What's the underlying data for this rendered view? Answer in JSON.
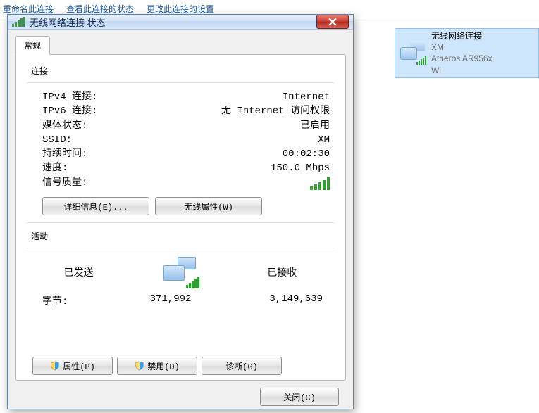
{
  "bgMenu": {
    "rename": "重命名此连接",
    "viewStatus": "查看此连接的状态",
    "changeSettings": "更改此连接的设置"
  },
  "connItem": {
    "name": "无线网络连接",
    "ssid": "XM",
    "adapter": "Atheros AR956x Wi"
  },
  "dlg": {
    "title": "无线网络连接 状态",
    "tab": "常规",
    "sectConn": "连接",
    "rows": {
      "ipv4k": "IPv4 连接:",
      "ipv4v": "Internet",
      "ipv6k": "IPv6 连接:",
      "ipv6v": "无 Internet 访问权限",
      "mediak": "媒体状态:",
      "mediav": "已启用",
      "ssidk": "SSID:",
      "ssidv": "XM",
      "durk": "持续时间:",
      "durv": "00:02:30",
      "speedk": "速度:",
      "speedv": "150.0 Mbps",
      "sigk": "信号质量:"
    },
    "btnDetails": "详细信息(E)...",
    "btnWireless": "无线属性(W)",
    "sectActivity": "活动",
    "sent": "已发送",
    "recv": "已接收",
    "bytesLabel": "字节:",
    "bytesSent": "371,992",
    "bytesRecv": "3,149,639",
    "btnProps": "属性(P)",
    "btnDisable": "禁用(D)",
    "btnDiag": "诊断(G)",
    "btnClose": "关闭(C)"
  }
}
